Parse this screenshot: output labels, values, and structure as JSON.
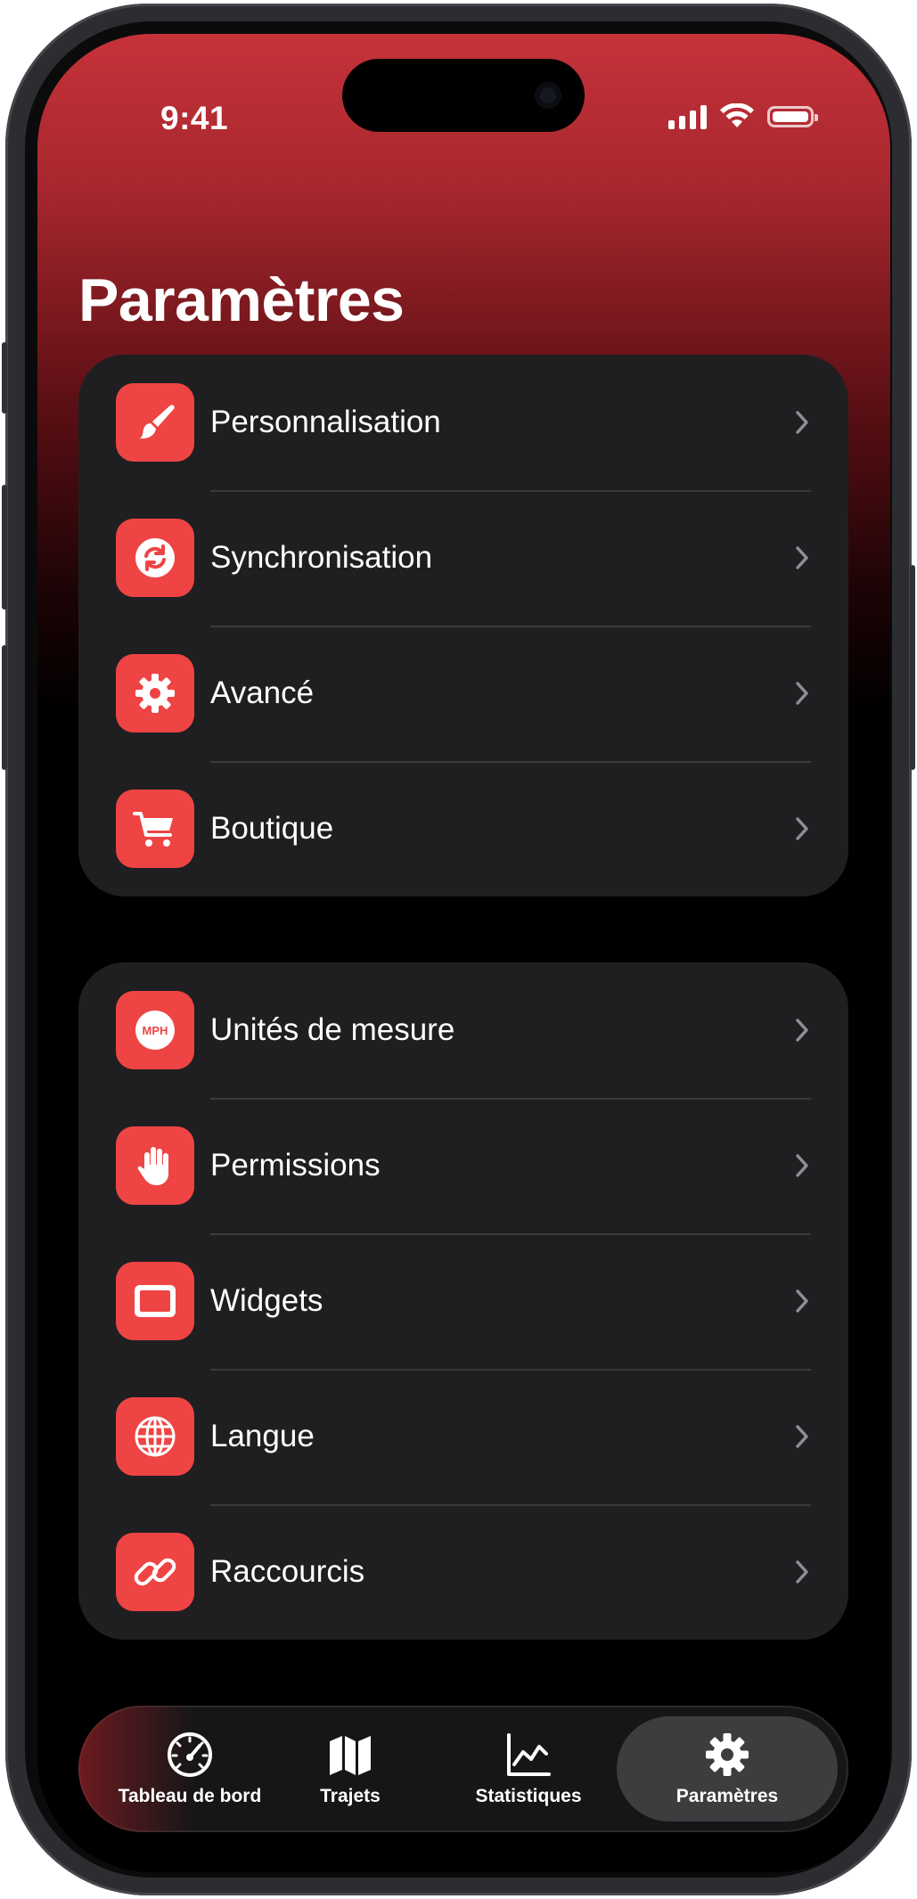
{
  "status_bar": {
    "time": "9:41"
  },
  "page": {
    "title": "Paramètres"
  },
  "groups": [
    {
      "items": [
        {
          "label": "Personnalisation",
          "icon": "paintbrush-icon"
        },
        {
          "label": "Synchronisation",
          "icon": "sync-icon"
        },
        {
          "label": "Avancé",
          "icon": "gear-icon"
        },
        {
          "label": "Boutique",
          "icon": "cart-icon"
        }
      ]
    },
    {
      "items": [
        {
          "label": "Unités de mesure",
          "icon": "mph-icon",
          "badge": "MPH"
        },
        {
          "label": "Permissions",
          "icon": "hand-icon"
        },
        {
          "label": "Widgets",
          "icon": "widget-icon"
        },
        {
          "label": "Langue",
          "icon": "globe-icon"
        },
        {
          "label": "Raccourcis",
          "icon": "link-icon"
        }
      ]
    }
  ],
  "tabbar": {
    "tabs": [
      {
        "label": "Tableau de bord",
        "icon": "speedometer-icon"
      },
      {
        "label": "Trajets",
        "icon": "map-icon"
      },
      {
        "label": "Statistiques",
        "icon": "chart-icon"
      },
      {
        "label": "Paramètres",
        "icon": "gear-icon",
        "active": true
      }
    ]
  },
  "colors": {
    "accent": "#ef4444",
    "header_gradient_top": "#c6323a",
    "card_background": "#1f1f21",
    "tab_active_background": "#3d3d40"
  }
}
